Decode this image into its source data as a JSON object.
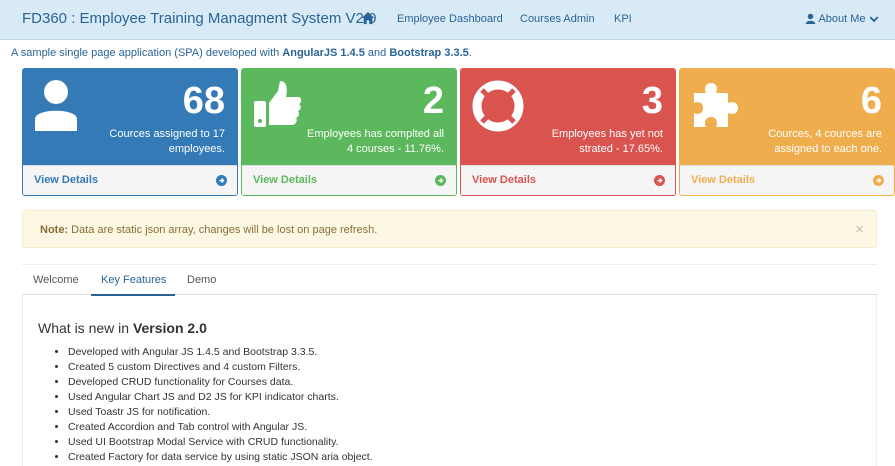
{
  "navbar": {
    "brand": "FD360 : Employee Training Managment System V2.0",
    "home_icon": "home-icon",
    "links": [
      "Employee Dashboard",
      "Courses Admin",
      "KPI"
    ],
    "about": "About Me",
    "user_icon": "user-icon",
    "caret_icon": "chevron-down-icon"
  },
  "intro": {
    "prefix": "A sample single page application (SPA) developed with ",
    "tech1": "AngularJS 1.4.5",
    "and": " and ",
    "tech2": "Bootstrap 3.3.5",
    "suffix": "."
  },
  "panels": [
    {
      "number": "68",
      "desc": "Cources assigned to 17 employees.",
      "link": "View Details",
      "icon": "user-icon",
      "color": "#337ab7"
    },
    {
      "number": "2",
      "desc": "Employees has complted all 4 courses - 11.76%.",
      "link": "View Details",
      "icon": "thumbs-up-icon",
      "color": "#5cb85c"
    },
    {
      "number": "3",
      "desc": "Employees has yet not strated - 17.65%.",
      "link": "View Details",
      "icon": "life-ring-icon",
      "color": "#d9534f"
    },
    {
      "number": "6",
      "desc": "Cources, 4 cources are assigned to each one.",
      "link": "View Details",
      "icon": "puzzle-icon",
      "color": "#f0ad4e"
    }
  ],
  "alert": {
    "label": "Note:",
    "text": " Data are static json array, changes will be lost on page refresh.",
    "close": "×"
  },
  "tabs": [
    "Welcome",
    "Key Features",
    "Demo"
  ],
  "active_tab": "Key Features",
  "content": {
    "heading_prefix": "What is new in ",
    "heading_bold": "Version 2.0",
    "items": [
      "Developed with Angular JS 1.4.5 and Bootstrap 3.3.5.",
      "Created 5 custom Directives and 4 custom Filters.",
      "Developed CRUD functionality for Courses data.",
      "Used Angular Chart JS and D2 JS for KPI indicator charts.",
      "Used Toastr JS for notification.",
      "Created Accordion and Tab control with Angular JS.",
      "Used UI Bootstrap Modal Service with CRUD functionality.",
      "Created Factory for data service by using static JSON aria object."
    ]
  }
}
